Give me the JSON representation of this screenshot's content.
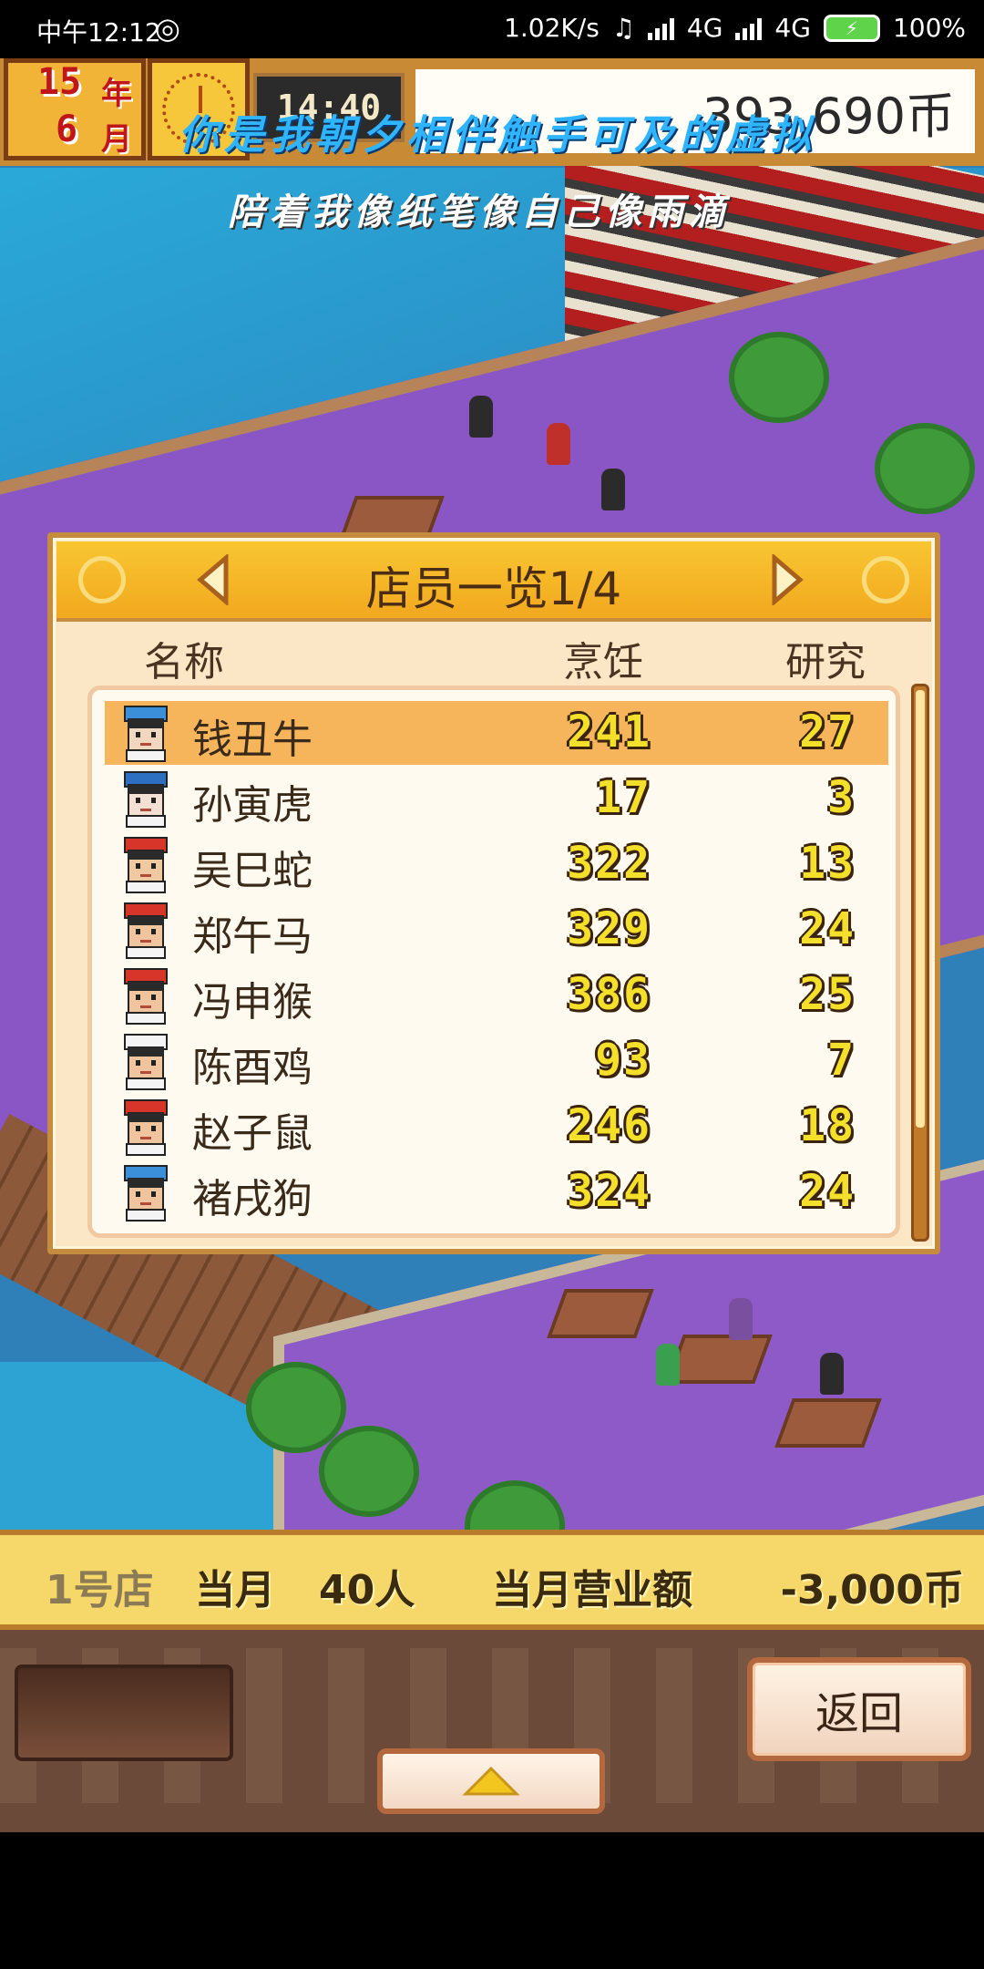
{
  "status_bar": {
    "time": "中午12:12",
    "network_speed": "1.02K/s",
    "network_type_1": "4G",
    "network_type_2": "4G",
    "battery": "100%"
  },
  "hud": {
    "year": "15",
    "year_unit": "年",
    "month": "6",
    "month_unit": "月",
    "clock": "14:40",
    "money": "393,690币"
  },
  "overlay": {
    "line1": "你是我朝夕相伴触手可及的虚拟",
    "line2": "陪着我像纸笔像自己像雨滴"
  },
  "dialog": {
    "title": "店员一览1/4",
    "columns": {
      "name": "名称",
      "cooking": "烹饪",
      "research": "研究"
    },
    "staff": [
      {
        "name": "钱丑牛",
        "cooking": "241",
        "research": "27"
      },
      {
        "name": "孙寅虎",
        "cooking": "17",
        "research": "3"
      },
      {
        "name": "吴巳蛇",
        "cooking": "322",
        "research": "13"
      },
      {
        "name": "郑午马",
        "cooking": "329",
        "research": "24"
      },
      {
        "name": "冯申猴",
        "cooking": "386",
        "research": "25"
      },
      {
        "name": "陈酉鸡",
        "cooking": "93",
        "research": "7"
      },
      {
        "name": "赵子鼠",
        "cooking": "246",
        "research": "18"
      },
      {
        "name": "褚戌狗",
        "cooking": "324",
        "research": "24"
      }
    ]
  },
  "info_bar": {
    "store": "1号店",
    "month_label": "当月",
    "customers": "40人",
    "sales_label": "当月营业额",
    "sales_amount": "-3,000币"
  },
  "controls": {
    "back_label": "返回"
  },
  "colors": {
    "accent_gold": "#f2b437",
    "selected_row": "#f6b55a",
    "pixel_number": "#f4df2a"
  }
}
